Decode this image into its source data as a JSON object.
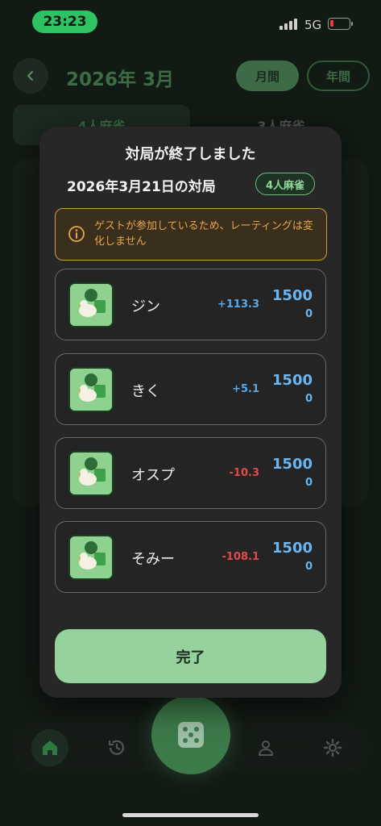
{
  "status_bar": {
    "time": "23:23",
    "network": "5G"
  },
  "header": {
    "month_title": "2026年 3月",
    "monthly_label": "月間",
    "yearly_label": "年間"
  },
  "mode_tabs": {
    "four_player": "4人麻雀",
    "three_player": "3人麻雀"
  },
  "modal": {
    "title": "対局が終了しました",
    "game_date": "2026年3月21日の対局",
    "mode_badge": "4人麻雀",
    "warning": "ゲストが参加しているため、レーティングは変化しません",
    "done_label": "完了"
  },
  "players": [
    {
      "name": "ジン",
      "delta": "+113.3",
      "rating": "1500",
      "rating_change": "0"
    },
    {
      "name": "きく",
      "delta": "+5.1",
      "rating": "1500",
      "rating_change": "0"
    },
    {
      "name": "オスプ",
      "delta": "-10.3",
      "rating": "1500",
      "rating_change": "0"
    },
    {
      "name": "そみー",
      "delta": "-108.1",
      "rating": "1500",
      "rating_change": "0"
    }
  ],
  "icons": [
    "back-icon",
    "info-icon",
    "home-icon",
    "history-icon",
    "dice-icon",
    "profile-icon",
    "settings-icon",
    "avatar-bird-icon"
  ],
  "colors": {
    "accent_green": "#96d29d",
    "positive": "#5aa8e6",
    "negative": "#e24c4c",
    "warning": "#e8a64a"
  }
}
